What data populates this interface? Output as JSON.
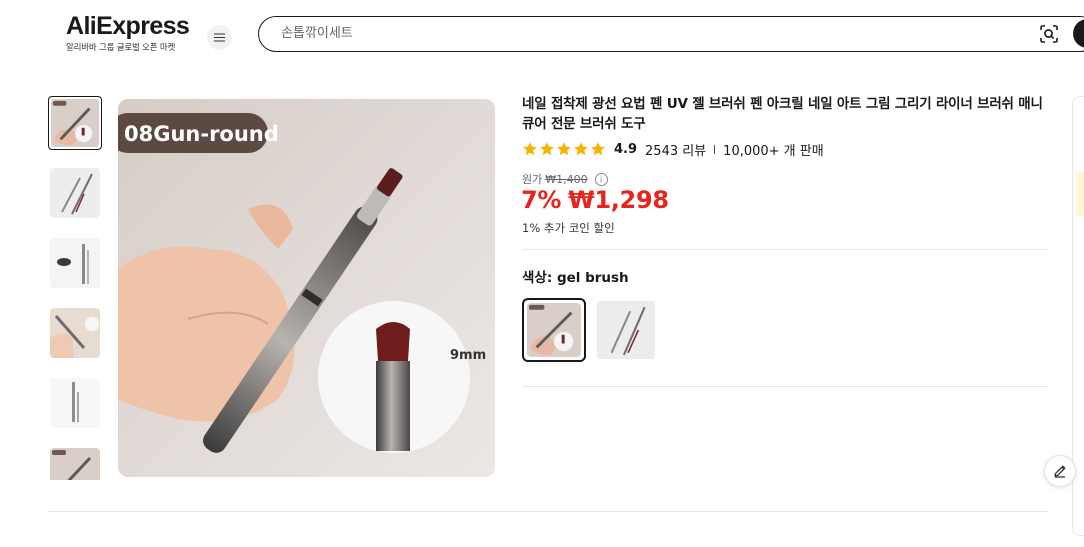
{
  "header": {
    "logo_text": "AliExpress",
    "logo_subtitle": "알리바바 그룹 글로벌 오픈 마켓",
    "menu_icon": "hamburger-icon",
    "search": {
      "placeholder": "손톱깎이세트",
      "value": ""
    },
    "camera_icon": "camera-search-icon"
  },
  "gallery": {
    "main_badge": "08Gun-round",
    "main_size_label": "9mm",
    "thumbnail_count": 6,
    "selected_thumbnail": 1
  },
  "product": {
    "title": "네일 접착제 광선 요법 펜 UV 젤 브러쉬 펜 아크릴 네일 아트 그림 그리기 라이너 브러쉬 매니큐어 전문 브러쉬 도구",
    "rating": "4.9",
    "star_count": 5,
    "reviews": "2543 리뷰",
    "sold": "10,000+ 개 판매",
    "original_label": "원가",
    "original_price": "₩1,400",
    "discount": "7%",
    "price": "₩1,298",
    "coin_discount": "1% 추가 코인 할인",
    "color_label": "색상: gel brush",
    "variants_count": 2,
    "selected_variant": 1
  },
  "colors": {
    "accent_red": "#e8251d",
    "star_yellow": "#f5b400",
    "text_dark": "#191919"
  },
  "side": {
    "edit_icon": "pencil-icon"
  }
}
